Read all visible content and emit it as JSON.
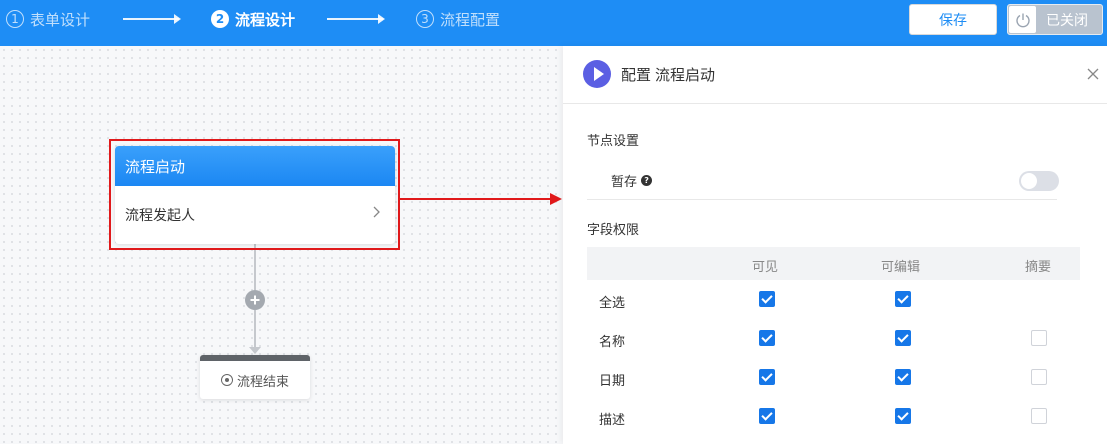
{
  "steps": [
    {
      "num": "1",
      "label": "表单设计",
      "state": "inactive"
    },
    {
      "num": "2",
      "label": "流程设计",
      "state": "active"
    },
    {
      "num": "3",
      "label": "流程配置",
      "state": "inactive"
    }
  ],
  "header": {
    "save_label": "保存",
    "toggle_label": "已关闭",
    "toggle_icon": "power-icon"
  },
  "canvas": {
    "start_node": {
      "title": "流程启动",
      "body": "流程发起人"
    },
    "add_icon": "plus-icon",
    "end_node": {
      "label": "流程结束"
    }
  },
  "panel": {
    "title_prefix": "配置",
    "title_node": "流程启动",
    "node_settings_title": "节点设置",
    "temp_save_label": "暂存",
    "temp_save_on": false,
    "field_permissions_title": "字段权限",
    "columns": [
      "可见",
      "可编辑",
      "摘要"
    ],
    "rows": [
      {
        "name": "全选",
        "visible": true,
        "editable": true,
        "summary": null
      },
      {
        "name": "名称",
        "visible": true,
        "editable": true,
        "summary": false
      },
      {
        "name": "日期",
        "visible": true,
        "editable": true,
        "summary": false
      },
      {
        "name": "描述",
        "visible": true,
        "editable": true,
        "summary": false
      }
    ]
  },
  "colors": {
    "primary": "#1e8df5",
    "highlight": "#e0191b",
    "checkbox": "#1677e8"
  }
}
